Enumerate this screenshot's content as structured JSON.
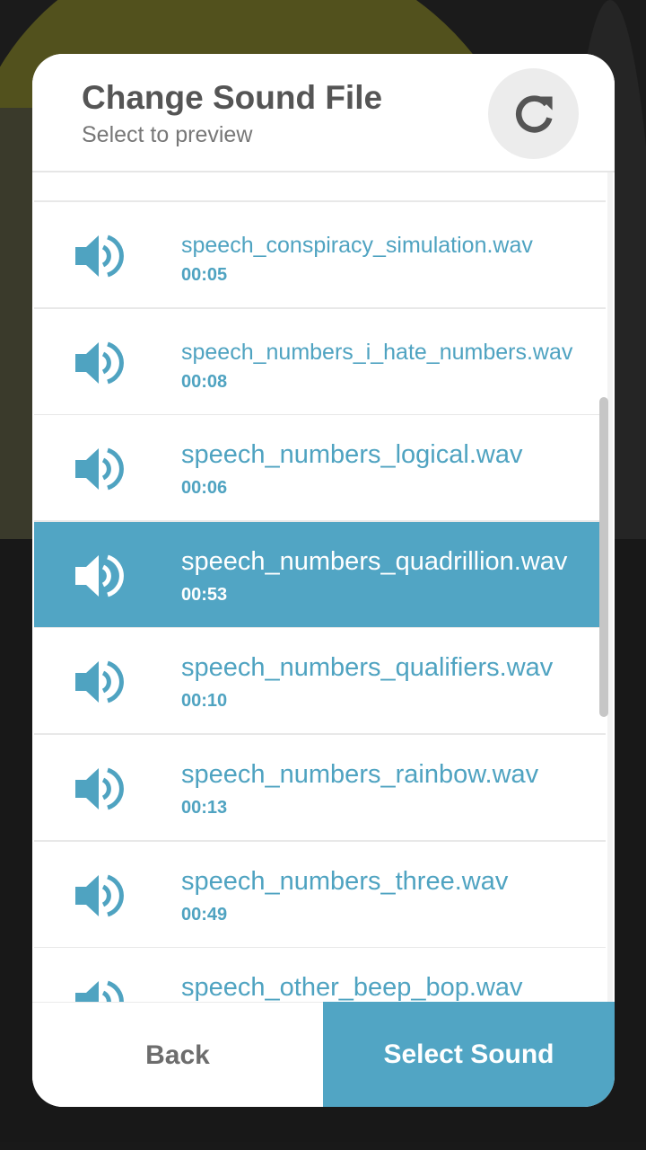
{
  "dialog": {
    "title": "Change Sound File",
    "subtitle": "Select to preview",
    "refresh_icon": "refresh-icon"
  },
  "sounds": [
    {
      "name": "speech_conspiracy_simulation.wav",
      "duration": "00:05",
      "selected": false
    },
    {
      "name": "speech_numbers_i_hate_numbers.wav",
      "duration": "00:08",
      "selected": false
    },
    {
      "name": "speech_numbers_logical.wav",
      "duration": "00:06",
      "selected": false
    },
    {
      "name": "speech_numbers_quadrillion.wav",
      "duration": "00:53",
      "selected": true
    },
    {
      "name": "speech_numbers_qualifiers.wav",
      "duration": "00:10",
      "selected": false
    },
    {
      "name": "speech_numbers_rainbow.wav",
      "duration": "00:13",
      "selected": false
    },
    {
      "name": "speech_numbers_three.wav",
      "duration": "00:49",
      "selected": false
    },
    {
      "name": "speech_other_beep_bop.wav",
      "duration": "",
      "selected": false
    }
  ],
  "footer": {
    "back_label": "Back",
    "select_label": "Select Sound"
  },
  "colors": {
    "accent": "#51a5c4",
    "text_title": "#555555"
  }
}
